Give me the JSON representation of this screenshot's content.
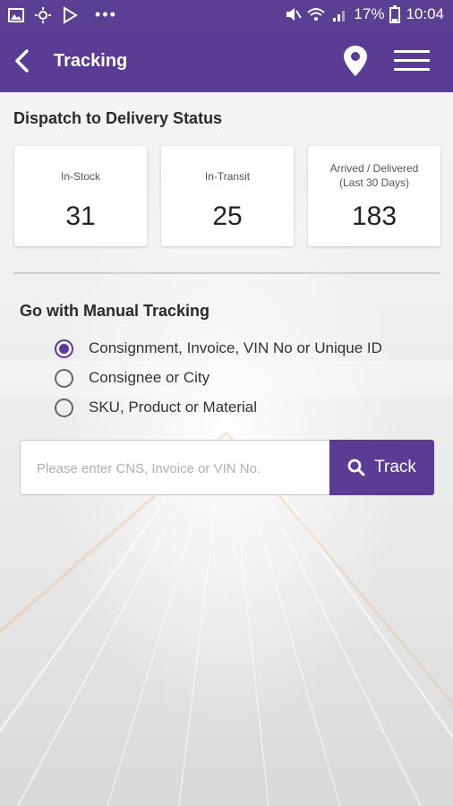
{
  "status_bar": {
    "battery": "17%",
    "time": "10:04"
  },
  "app_bar": {
    "title": "Tracking"
  },
  "dispatch": {
    "title": "Dispatch to Delivery Status",
    "cards": [
      {
        "label": "In-Stock",
        "value": "31"
      },
      {
        "label": "In-Transit",
        "value": "25"
      },
      {
        "label": "Arrived / Delivered",
        "label2": "(Last 30 Days)",
        "value": "183"
      }
    ]
  },
  "manual": {
    "title": "Go with Manual Tracking",
    "options": [
      {
        "label": "Consignment, Invoice, VIN No or Unique ID",
        "selected": true
      },
      {
        "label": "Consignee or City",
        "selected": false
      },
      {
        "label": "SKU, Product or Material",
        "selected": false
      }
    ],
    "search": {
      "placeholder": "Please enter CNS, Invoice or VIN No.",
      "value": ""
    },
    "track_label": "Track"
  },
  "colors": {
    "primary": "#5b3c95",
    "status_bar": "#5a3f93"
  },
  "icons": {
    "back": "back-arrow-icon",
    "location": "location-pin-icon",
    "menu": "hamburger-menu-icon",
    "search": "search-icon"
  }
}
